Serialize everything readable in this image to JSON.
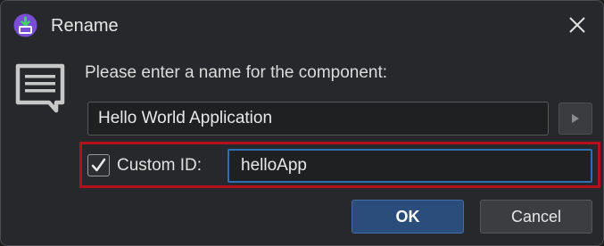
{
  "dialog": {
    "title": "Rename",
    "prompt": "Please enter a name for the component:",
    "app_icon": "download-box-icon",
    "message_icon": "message-lines-icon",
    "close_icon": "close-icon"
  },
  "form": {
    "name_value": "Hello World Application",
    "arrow_icon": "triangle-right-icon",
    "custom_id": {
      "checked": true,
      "label": "Custom ID:",
      "value": "helloApp"
    }
  },
  "buttons": {
    "ok_label": "OK",
    "cancel_label": "Cancel"
  },
  "colors": {
    "highlight": "#b5101b",
    "focus_border": "#2f6fb5",
    "ok_background": "#2a4d7c"
  }
}
